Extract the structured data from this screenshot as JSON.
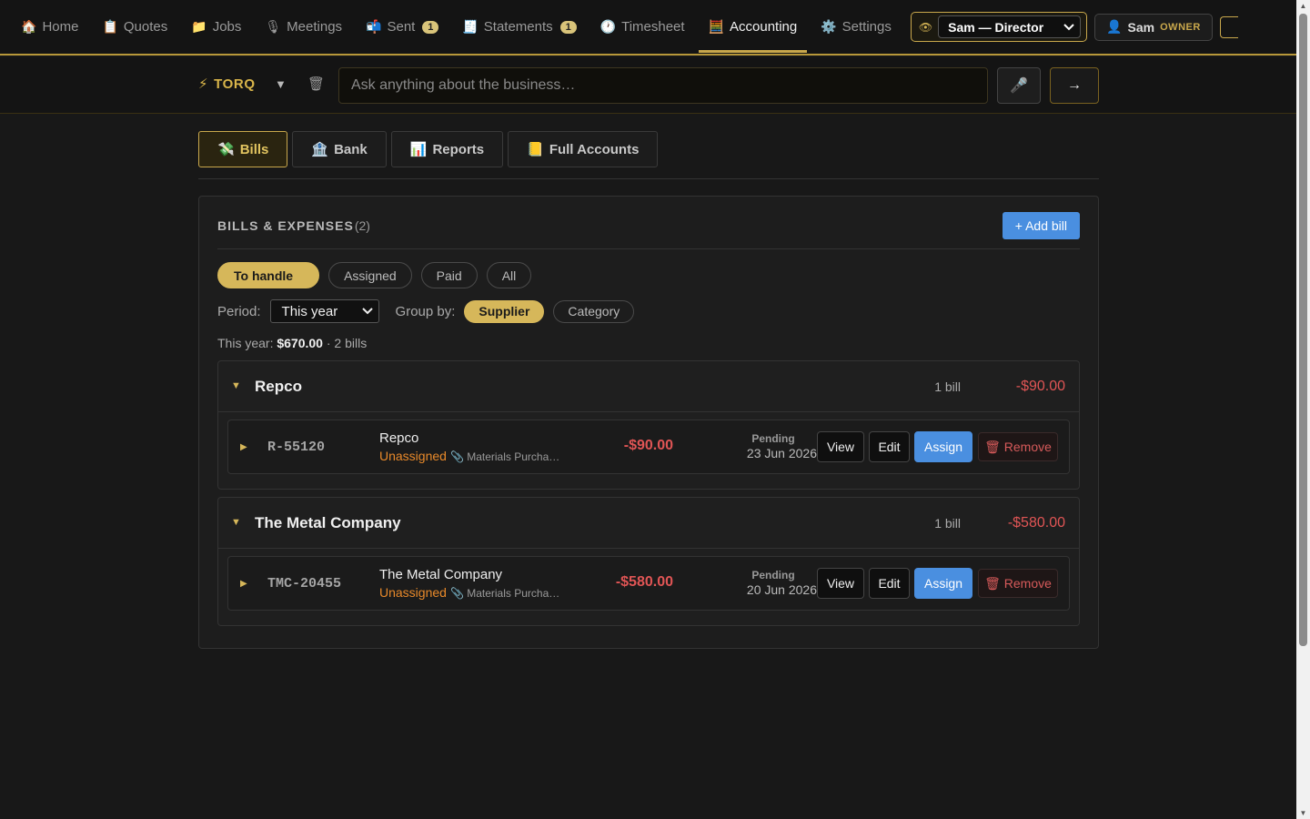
{
  "nav": {
    "items": [
      {
        "icon": "🏠",
        "label": "Home",
        "badge": ""
      },
      {
        "icon": "📋",
        "label": "Quotes",
        "badge": ""
      },
      {
        "icon": "📁",
        "label": "Jobs",
        "badge": ""
      },
      {
        "icon": "🎙",
        "label": "Meetings",
        "badge": ""
      },
      {
        "icon": "📬",
        "label": "Sent",
        "badge": "1"
      },
      {
        "icon": "🧾",
        "label": "Statements",
        "badge": "1"
      },
      {
        "icon": "🕐",
        "label": "Timesheet",
        "badge": ""
      },
      {
        "icon": "🧮",
        "label": "Accounting",
        "badge": ""
      },
      {
        "icon": "⚙️",
        "label": "Settings",
        "badge": ""
      }
    ],
    "active": "Accounting",
    "role_icon": "👁",
    "role_value": "Sam — Director",
    "user_icon": "👤",
    "user_name": "Sam",
    "user_role": "OWNER"
  },
  "askbar": {
    "brand_icon": "⚡",
    "brand": "TORQ",
    "caret": "▼",
    "trash_icon": "🗑",
    "placeholder": "Ask anything about the business…",
    "mic_icon": "🎤",
    "send_icon": "→"
  },
  "subtabs": [
    {
      "icon": "💸",
      "label": "Bills"
    },
    {
      "icon": "🏦",
      "label": "Bank"
    },
    {
      "icon": "📊",
      "label": "Reports"
    },
    {
      "icon": "📒",
      "label": "Full Accounts"
    }
  ],
  "panel": {
    "title": "BILLS & EXPENSES",
    "count": "(2)",
    "add_label": "+ Add bill",
    "filters": [
      "To handle",
      "Assigned",
      "Paid",
      "All"
    ],
    "period_label": "Period:",
    "period_value": "This year",
    "groupby_label": "Group by:",
    "groupby_options": [
      "Supplier",
      "Category"
    ],
    "summary_prefix": "This year:",
    "summary_total": "$670.00",
    "summary_suffix": "· 2 bills"
  },
  "groups": [
    {
      "name": "Repco",
      "count": "1 bill",
      "amount": "-$90.00",
      "bill": {
        "ref": "R-55120",
        "supplier": "Repco",
        "assign_status": "Unassigned",
        "category": "📎 Materials Purcha…",
        "amount": "-$90.00",
        "status": "Pending",
        "date": "23 Jun 2026"
      }
    },
    {
      "name": "The Metal Company",
      "count": "1 bill",
      "amount": "-$580.00",
      "bill": {
        "ref": "TMC-20455",
        "supplier": "The Metal Company",
        "assign_status": "Unassigned",
        "category": "📎 Materials Purcha…",
        "amount": "-$580.00",
        "status": "Pending",
        "date": "20 Jun 2026"
      }
    }
  ],
  "actions": {
    "view": "View",
    "edit": "Edit",
    "assign": "Assign",
    "remove": "🗑 Remove"
  },
  "colors": {
    "accent": "#c9a84c",
    "primary": "#4a8fe0",
    "negative": "#e05555",
    "warning": "#e8892a"
  }
}
